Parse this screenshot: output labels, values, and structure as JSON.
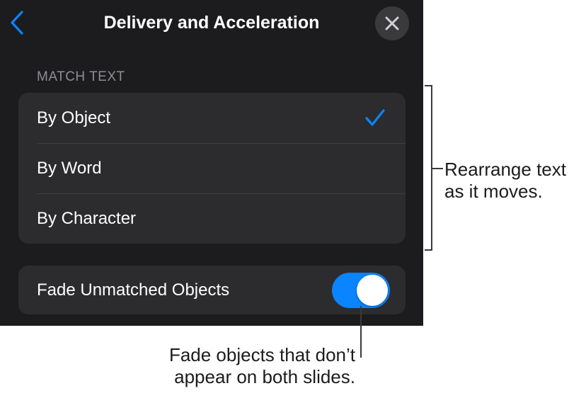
{
  "header": {
    "title": "Delivery and Acceleration",
    "back_icon": "chevron-left-icon",
    "close_icon": "close-icon"
  },
  "match_text": {
    "section_label": "MATCH TEXT",
    "options": [
      {
        "label": "By Object",
        "selected": true
      },
      {
        "label": "By Word",
        "selected": false
      },
      {
        "label": "By Character",
        "selected": false
      }
    ]
  },
  "fade": {
    "label": "Fade Unmatched Objects",
    "enabled": true
  },
  "callouts": {
    "rearrange_line1": "Rearrange text",
    "rearrange_line2": "as it moves.",
    "fade_line1": "Fade objects that don’t",
    "fade_line2": "appear on both slides."
  },
  "colors": {
    "accent": "#0a84ff",
    "panel_bg": "#1c1c1e",
    "group_bg": "#2c2c2e"
  }
}
